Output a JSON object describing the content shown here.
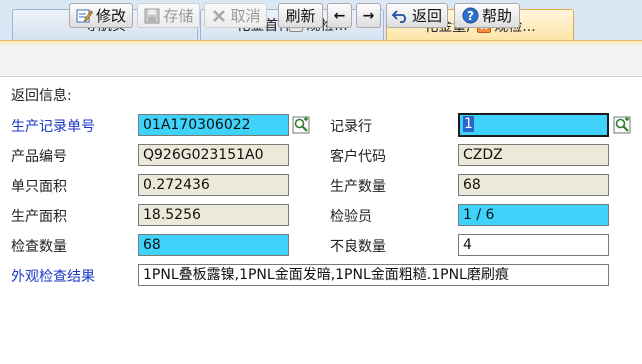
{
  "tabs": [
    {
      "label": "导航页",
      "active": false,
      "closable": false
    },
    {
      "label": "化金首件外观检...",
      "active": false,
      "closable": true
    },
    {
      "label": "化金量产外观检...",
      "active": true,
      "closable": true
    }
  ],
  "toolbar": {
    "edit": "修改",
    "save": "存储",
    "cancel": "取消",
    "refresh": "刷新",
    "prev": "←",
    "next": "→",
    "back": "返回",
    "help": "帮助"
  },
  "section_title": "返回信息:",
  "form": {
    "production_record_no_label": "生产记录单号",
    "production_record_no": "01A170306022",
    "record_row_label": "记录行",
    "record_row": "1",
    "product_no_label": "产品编号",
    "product_no": "Q926G023151A0",
    "customer_code_label": "客户代码",
    "customer_code": "CZDZ",
    "unit_area_label": "单只面积",
    "unit_area": "0.272436",
    "production_qty_label": "生产数量",
    "production_qty": "68",
    "production_area_label": "生产面积",
    "production_area": "18.5256",
    "inspector_label": "检验员",
    "inspector": "1 / 6",
    "check_qty_label": "检查数量",
    "check_qty": "68",
    "defect_qty_label": "不良数量",
    "defect_qty": "4",
    "result_label": "外观检查结果",
    "result": "1PNL叠板露镍,1PNL金面发暗,1PNL金面粗糙.1PNL磨刷痕"
  },
  "colors": {
    "required_field": "#3fd2fb",
    "readonly_field": "#ece9d8",
    "link_label": "#1a37c6",
    "active_tab": "#fde4a6"
  }
}
